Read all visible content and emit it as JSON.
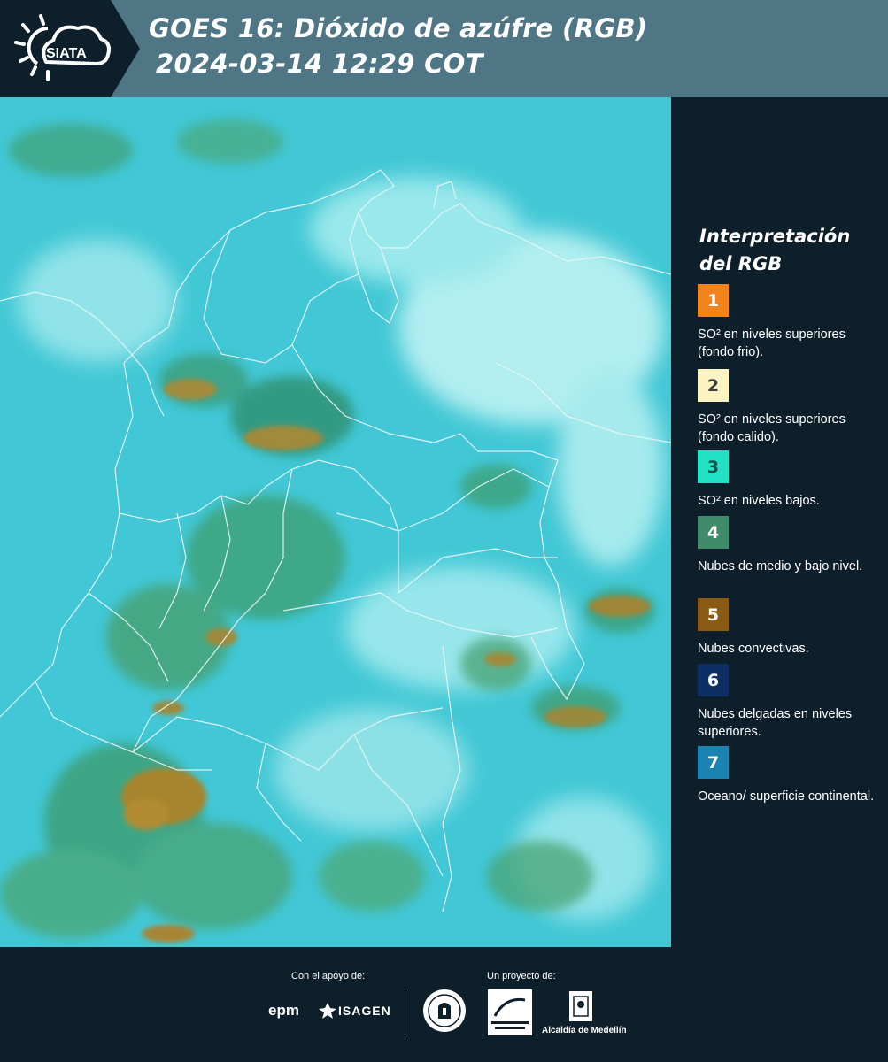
{
  "header": {
    "logo_text": "SIATA",
    "title_line1": "GOES 16: Dióxido de azúfre (RGB)",
    "title_line2": "2024-03-14 12:29 COT"
  },
  "legend": {
    "title_line1": "Interpretación",
    "title_line2": "del RGB",
    "items": [
      {
        "number": "1",
        "color": "#f3841c",
        "desc": "SO² en niveles superiores (fondo frio)."
      },
      {
        "number": "2",
        "color": "#fbf3c2",
        "desc": "SO² en niveles superiores (fondo calido)."
      },
      {
        "number": "3",
        "color": "#22e0c4",
        "desc": "SO² en niveles bajos."
      },
      {
        "number": "4",
        "color": "#3f8b6a",
        "desc": "Nubes de medio y bajo nivel."
      },
      {
        "number": "5",
        "color": "#8b5a12",
        "desc": "Nubes convectivas."
      },
      {
        "number": "6",
        "color": "#0d2f62",
        "desc": "Nubes delgadas en niveles superiores."
      },
      {
        "number": "7",
        "color": "#1b83b2",
        "desc": "Oceano/ superficie continental."
      }
    ]
  },
  "footer": {
    "support_label": "Con el apoyo de:",
    "project_label": "Un proyecto de:",
    "sponsors": [
      "epm",
      "ISAGEN"
    ],
    "partners": [
      "Área Metropolitana Valle de Aburrá",
      "Alcaldía de Medellín"
    ]
  },
  "colors": {
    "header_bg": "#4f7685",
    "sidebar_bg": "#0e1f2c",
    "map_base": "#41c7d5",
    "map_cloud": "#bff3f3",
    "map_green": "#3d9a6a",
    "map_brown": "#8f7a2a"
  }
}
